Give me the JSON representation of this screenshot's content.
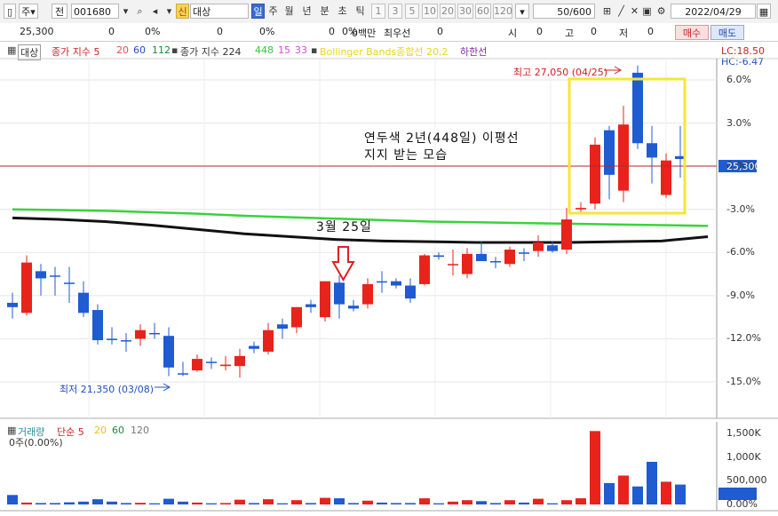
{
  "toolbar": {
    "market": "주",
    "mode": "전",
    "code": "001680",
    "badge": "신",
    "name": "대상",
    "periods": [
      "일",
      "주",
      "월",
      "년",
      "분",
      "초",
      "틱"
    ],
    "intervals": [
      "1",
      "3",
      "5",
      "10",
      "20",
      "30",
      "60",
      "120"
    ],
    "count": "50/600",
    "date": "2022/04/29"
  },
  "quote": {
    "price": "25,300",
    "change": "0",
    "pct": "0%",
    "v1": "0",
    "pct2": "0%",
    "v2": "0",
    "pct3": "0%",
    "unit": "0백만",
    "best_label": "최우선",
    "best": "0",
    "open_label": "시",
    "open": "0",
    "high_label": "고",
    "high": "0",
    "low_label": "저",
    "low": "0",
    "buy": "매수",
    "sell": "매도"
  },
  "legend": {
    "name": "대상",
    "ma_label": "종가 지수 5",
    "ma20": "20",
    "ma60": "60",
    "ma112": "112",
    "ma2_label": "종가 지수 224",
    "ma448": "448",
    "ma15": "15",
    "ma33": "33",
    "bb": "Bollinger Bands종합선 20,2",
    "low_line": "하한선",
    "lc": "LC:18.50",
    "hc": "HC:-6.47"
  },
  "annotations": {
    "high": "최고 27,050 (04/25)",
    "low": "최저 21,350 (03/08)",
    "note1": "연두색 2년(448일) 이평선",
    "note2": "지지 받는 모습",
    "march": "3월 25일",
    "current": "25,300"
  },
  "volume_legend": {
    "label": "거래량",
    "ma_label": "단순 5",
    "ma20": "20",
    "ma60": "60",
    "ma120": "120",
    "info": "0주(0.00%)"
  },
  "colors": {
    "up": "#e8231c",
    "down": "#1f5bd1",
    "ma448": "#39d339",
    "ma224": "#111111",
    "bb": "#f5f522",
    "mid": "#7b2a9c"
  },
  "chart_data": {
    "type": "candlestick",
    "y_axis_ticks": [
      "6.0%",
      "3.0%",
      "0.00%",
      "-3.0%",
      "-6.0%",
      "-9.0%",
      "-12.0%",
      "-15.0%"
    ],
    "y_axis_values": [
      6,
      3,
      0,
      -3,
      -6,
      -9,
      -12,
      -15
    ],
    "volume_ticks": [
      "1,500K",
      "1,000K",
      "500,000",
      "0.00%"
    ],
    "volume_values": [
      1500,
      1000,
      500,
      0
    ],
    "candles": [
      {
        "o": -9.5,
        "h": -8.8,
        "l": -10.6,
        "c": -9.8,
        "up": false
      },
      {
        "o": -10.2,
        "h": -6.2,
        "l": -10.4,
        "c": -6.7,
        "up": true
      },
      {
        "o": -7.8,
        "h": -6.8,
        "l": -9.0,
        "c": -7.3,
        "up": false
      },
      {
        "o": -7.6,
        "h": -7.0,
        "l": -9.0,
        "c": -7.6,
        "up": false
      },
      {
        "o": -8.1,
        "h": -7.0,
        "l": -9.5,
        "c": -8.1,
        "up": false
      },
      {
        "o": -8.8,
        "h": -8.0,
        "l": -10.5,
        "c": -10.2,
        "up": false
      },
      {
        "o": -10.0,
        "h": -9.6,
        "l": -12.4,
        "c": -12.1,
        "up": false
      },
      {
        "o": -12.0,
        "h": -11.2,
        "l": -12.4,
        "c": -12.0,
        "up": false
      },
      {
        "o": -12.1,
        "h": -11.6,
        "l": -12.9,
        "c": -12.1,
        "up": false
      },
      {
        "o": -12.0,
        "h": -11.0,
        "l": -12.5,
        "c": -11.4,
        "up": true
      },
      {
        "o": -11.6,
        "h": -10.9,
        "l": -12.0,
        "c": -11.6,
        "up": false
      },
      {
        "o": -11.8,
        "h": -11.2,
        "l": -14.6,
        "c": -14.0,
        "up": false
      },
      {
        "o": -14.4,
        "h": -13.6,
        "l": -14.6,
        "c": -14.4,
        "up": false
      },
      {
        "o": -14.2,
        "h": -13.1,
        "l": -14.3,
        "c": -13.4,
        "up": true
      },
      {
        "o": -13.6,
        "h": -13.3,
        "l": -14.1,
        "c": -13.6,
        "up": false
      },
      {
        "o": -13.9,
        "h": -13.2,
        "l": -14.2,
        "c": -13.8,
        "up": true
      },
      {
        "o": -13.9,
        "h": -12.7,
        "l": -14.7,
        "c": -13.2,
        "up": true
      },
      {
        "o": -12.5,
        "h": -12.2,
        "l": -13.0,
        "c": -12.7,
        "up": false
      },
      {
        "o": -12.9,
        "h": -10.9,
        "l": -13.1,
        "c": -11.4,
        "up": true
      },
      {
        "o": -11.0,
        "h": -10.6,
        "l": -12.0,
        "c": -11.3,
        "up": false
      },
      {
        "o": -11.2,
        "h": -9.8,
        "l": -11.6,
        "c": -9.8,
        "up": true
      },
      {
        "o": -9.8,
        "h": -9.3,
        "l": -10.2,
        "c": -9.6,
        "up": false
      },
      {
        "o": -10.5,
        "h": -8.0,
        "l": -10.8,
        "c": -8.0,
        "up": true
      },
      {
        "o": -8.1,
        "h": -7.6,
        "l": -10.6,
        "c": -9.6,
        "up": false
      },
      {
        "o": -9.7,
        "h": -9.3,
        "l": -10.1,
        "c": -9.9,
        "up": false
      },
      {
        "o": -9.6,
        "h": -7.8,
        "l": -9.9,
        "c": -8.2,
        "up": true
      },
      {
        "o": -8.0,
        "h": -7.3,
        "l": -8.8,
        "c": -8.0,
        "up": false
      },
      {
        "o": -8.0,
        "h": -7.8,
        "l": -8.5,
        "c": -8.3,
        "up": false
      },
      {
        "o": -8.3,
        "h": -7.8,
        "l": -9.5,
        "c": -9.2,
        "up": false
      },
      {
        "o": -8.2,
        "h": -6.1,
        "l": -8.3,
        "c": -6.2,
        "up": true
      },
      {
        "o": -6.2,
        "h": -6.0,
        "l": -6.5,
        "c": -6.3,
        "up": false
      },
      {
        "o": -6.8,
        "h": -5.8,
        "l": -7.6,
        "c": -6.8,
        "up": true
      },
      {
        "o": -7.5,
        "h": -5.7,
        "l": -7.8,
        "c": -6.1,
        "up": true
      },
      {
        "o": -6.1,
        "h": -5.2,
        "l": -6.6,
        "c": -6.6,
        "up": false
      },
      {
        "o": -6.6,
        "h": -6.3,
        "l": -7.1,
        "c": -6.6,
        "up": false
      },
      {
        "o": -6.8,
        "h": -5.6,
        "l": -7.0,
        "c": -5.8,
        "up": true
      },
      {
        "o": -6.0,
        "h": -5.7,
        "l": -6.6,
        "c": -6.0,
        "up": false
      },
      {
        "o": -5.9,
        "h": -4.8,
        "l": -6.3,
        "c": -5.3,
        "up": true
      },
      {
        "o": -5.5,
        "h": -5.2,
        "l": -6.0,
        "c": -5.9,
        "up": false
      },
      {
        "o": -5.8,
        "h": -2.9,
        "l": -6.1,
        "c": -3.7,
        "up": true
      },
      {
        "o": -3.0,
        "h": -2.5,
        "l": -3.3,
        "c": -2.9,
        "up": true
      },
      {
        "o": -2.6,
        "h": 2.0,
        "l": -3.0,
        "c": 1.5,
        "up": true
      },
      {
        "o": 2.5,
        "h": 2.8,
        "l": -2.3,
        "c": -0.6,
        "up": false
      },
      {
        "o": -1.7,
        "h": 4.2,
        "l": -2.5,
        "c": 2.9,
        "up": true
      },
      {
        "o": 6.5,
        "h": 7.0,
        "l": 1.2,
        "c": 1.6,
        "up": false
      },
      {
        "o": 1.6,
        "h": 2.8,
        "l": -1.2,
        "c": 0.6,
        "up": false
      },
      {
        "o": -2.0,
        "h": 0.9,
        "l": -2.2,
        "c": 0.4,
        "up": true
      },
      {
        "o": 0.7,
        "h": 2.8,
        "l": -0.8,
        "c": 0.5,
        "up": false
      }
    ],
    "volumes": [
      200,
      40,
      30,
      30,
      45,
      60,
      110,
      60,
      30,
      35,
      25,
      120,
      60,
      40,
      25,
      30,
      100,
      30,
      110,
      25,
      90,
      30,
      140,
      130,
      30,
      80,
      40,
      30,
      30,
      130,
      25,
      60,
      90,
      70,
      30,
      90,
      40,
      120,
      25,
      90,
      130,
      1550,
      450,
      610,
      380,
      900,
      480,
      420
    ],
    "ma448": [
      -3.0,
      -3.05,
      -3.1,
      -3.2,
      -3.3,
      -3.45,
      -3.55,
      -3.65,
      -3.75,
      -3.85,
      -3.9,
      -3.95,
      -4.0,
      -4.05,
      -4.1,
      -4.15
    ],
    "ma224": [
      -3.6,
      -3.7,
      -3.85,
      -4.1,
      -4.4,
      -4.7,
      -4.9,
      -5.1,
      -5.2,
      -5.25,
      -5.3,
      -5.3,
      -5.3,
      -5.25,
      -5.2,
      -4.9
    ]
  }
}
